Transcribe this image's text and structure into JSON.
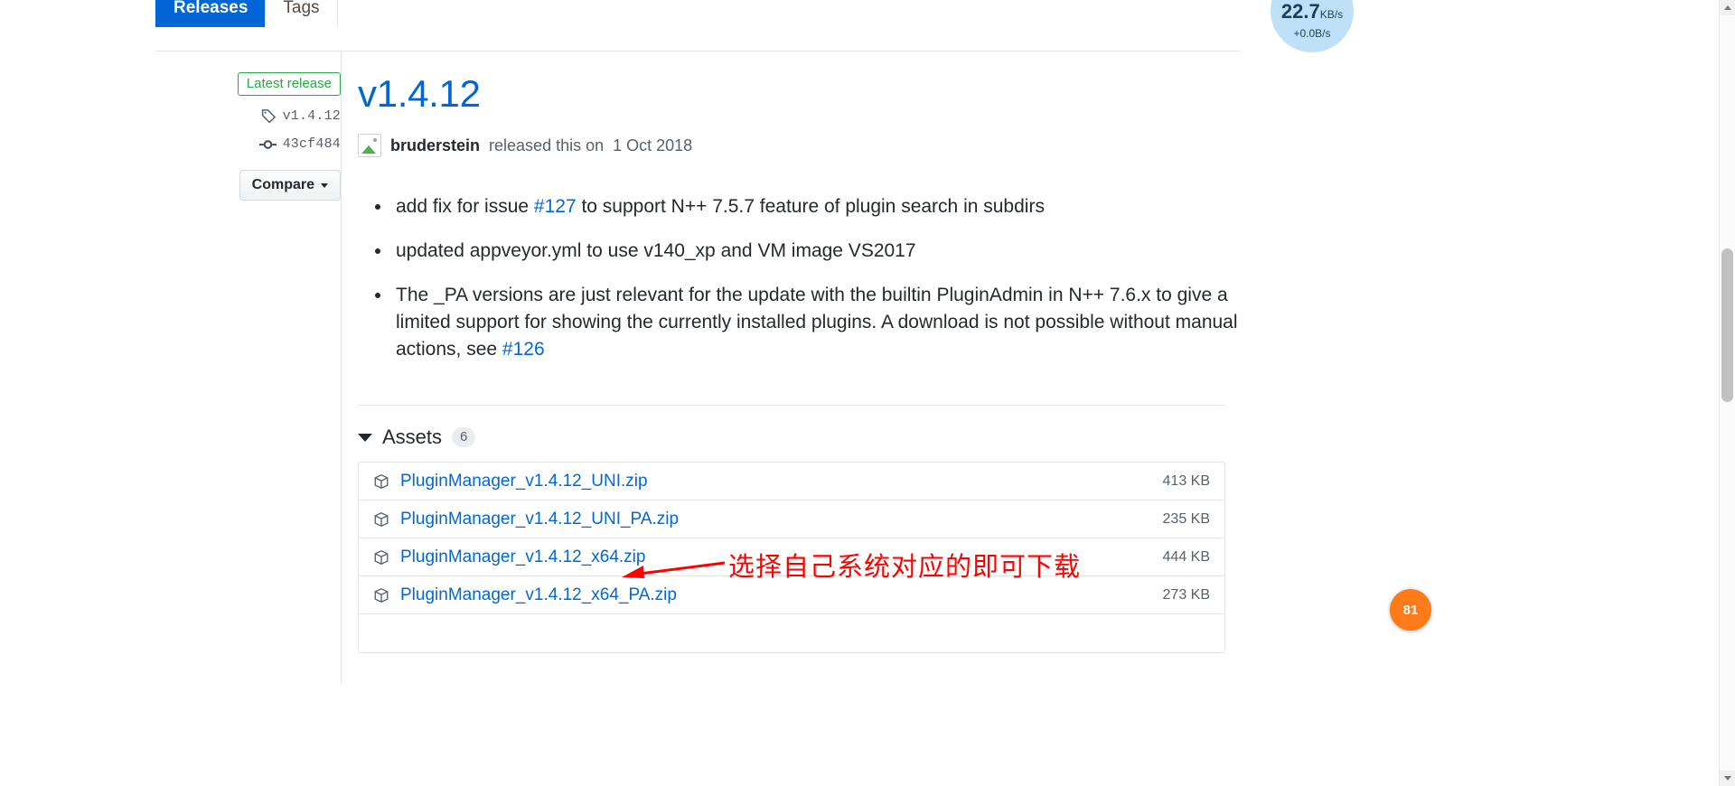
{
  "tabs": [
    {
      "label": "Releases",
      "active": true
    },
    {
      "label": "Tags",
      "active": false
    }
  ],
  "sidebar": {
    "latest_badge": "Latest release",
    "tag_icon": "tag-icon",
    "tag_name": "v1.4.12",
    "commit_icon": "commit-icon",
    "commit_sha": "43cf484",
    "compare_label": "Compare"
  },
  "release": {
    "title": "v1.4.12",
    "avatar_icon": "broken-image-avatar-icon",
    "author": "bruderstein",
    "byline_middle": "released this on",
    "date": "1 Oct 2018",
    "notes": [
      {
        "parts": [
          {
            "t": "add fix for issue ",
            "link": false
          },
          {
            "t": "#127",
            "link": true
          },
          {
            "t": " to support N++ 7.5.7 feature of plugin search in subdirs",
            "link": false
          }
        ]
      },
      {
        "parts": [
          {
            "t": "updated appveyor.yml to use v140_xp and VM image VS2017",
            "link": false
          }
        ]
      },
      {
        "parts": [
          {
            "t": "The _PA versions are just relevant for the update with the builtin PluginAdmin in N++ 7.6.x to give a limited support for showing the currently installed plugins. A download is not possible without manual actions, see ",
            "link": false
          },
          {
            "t": "#126",
            "link": true
          }
        ]
      }
    ]
  },
  "assets": {
    "label": "Assets",
    "count": "6",
    "toggle_icon": "triangle-down-icon",
    "rows": [
      {
        "icon": "package-icon",
        "name": "PluginManager_v1.4.12_UNI.zip",
        "size": "413 KB"
      },
      {
        "icon": "package-icon",
        "name": "PluginManager_v1.4.12_UNI_PA.zip",
        "size": "235 KB"
      },
      {
        "icon": "package-icon",
        "name": "PluginManager_v1.4.12_x64.zip",
        "size": "444 KB"
      },
      {
        "icon": "package-icon",
        "name": "PluginManager_v1.4.12_x64_PA.zip",
        "size": "273 KB"
      }
    ]
  },
  "annotation": {
    "text": "选择自己系统对应的即可下载",
    "color": "#ff0000",
    "arrow_icon": "arrow-left-icon"
  },
  "speed_widget": {
    "value": "22.7",
    "unit": "KB/s",
    "delta": "+0.0B/s",
    "color": "#bfe0f7"
  },
  "corner_badge": {
    "text": "81"
  },
  "scrollbar": {
    "up_icon": "scroll-up-arrow-icon",
    "down_icon": "scroll-down-arrow-icon",
    "thumb": "scroll-thumb"
  }
}
